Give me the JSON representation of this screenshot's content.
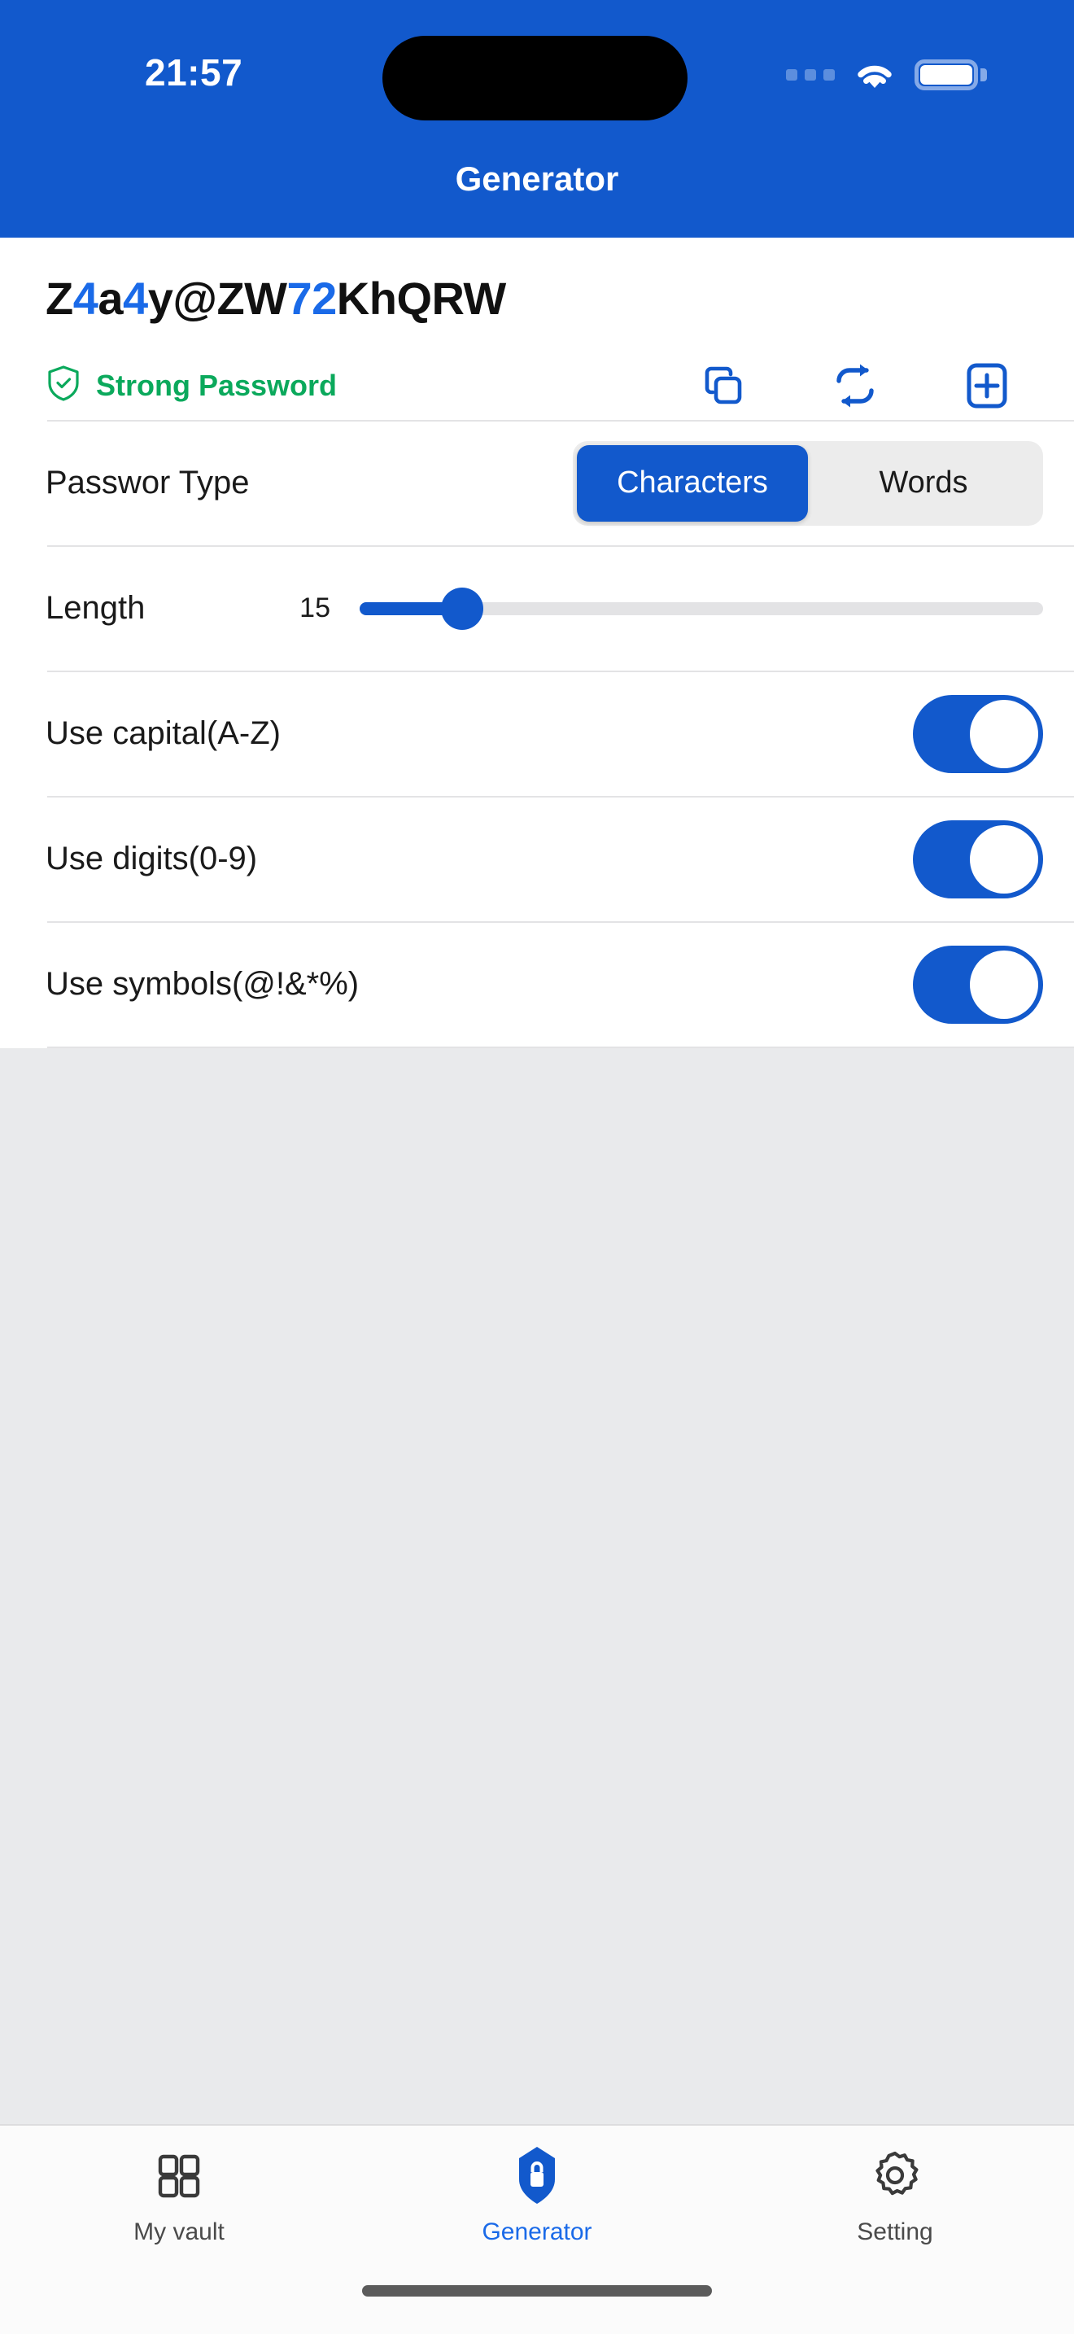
{
  "status_bar": {
    "time": "21:57",
    "cellular_icon": "cellular-dots-icon",
    "wifi_icon": "wifi-icon",
    "battery_icon": "battery-full-icon"
  },
  "header": {
    "title": "Generator",
    "background_color": "#1259CC"
  },
  "password": {
    "value": "Z4a4y@ZW72KhQRW",
    "segments": [
      {
        "text": "Z",
        "highlight": false
      },
      {
        "text": "4",
        "highlight": true
      },
      {
        "text": "a",
        "highlight": false
      },
      {
        "text": "4",
        "highlight": true
      },
      {
        "text": "y@ZW",
        "highlight": false
      },
      {
        "text": "72",
        "highlight": true
      },
      {
        "text": "KhQRW",
        "highlight": false
      }
    ],
    "highlight_color": "#1A6AE8",
    "strength_label": "Strong Password",
    "strength_color": "#0BA95C",
    "strength_icon": "shield-check-icon"
  },
  "actions": [
    {
      "name": "copy-button",
      "icon": "copy-icon",
      "color": "#1259CC"
    },
    {
      "name": "regenerate-button",
      "icon": "refresh-icon",
      "color": "#1259CC"
    },
    {
      "name": "add-button",
      "icon": "plus-square-icon",
      "color": "#1259CC"
    }
  ],
  "settings": {
    "password_type": {
      "label": "Passwor Type",
      "options": [
        "Characters",
        "Words"
      ],
      "selected": "Characters"
    },
    "length": {
      "label": "Length",
      "value": "15",
      "percent": 15
    },
    "toggles": [
      {
        "label": "Use capital(A-Z)",
        "on": true
      },
      {
        "label": "Use digits(0-9)",
        "on": true
      },
      {
        "label": "Use symbols(@!&*%)",
        "on": true
      }
    ]
  },
  "tabbar": {
    "items": [
      {
        "label": "My vault",
        "icon": "grid-icon",
        "active": false
      },
      {
        "label": "Generator",
        "icon": "shield-lock-icon",
        "active": true
      },
      {
        "label": "Setting",
        "icon": "gear-icon",
        "active": false
      }
    ],
    "active_color": "#1A6AE8",
    "inactive_color": "#4A4A4A"
  }
}
